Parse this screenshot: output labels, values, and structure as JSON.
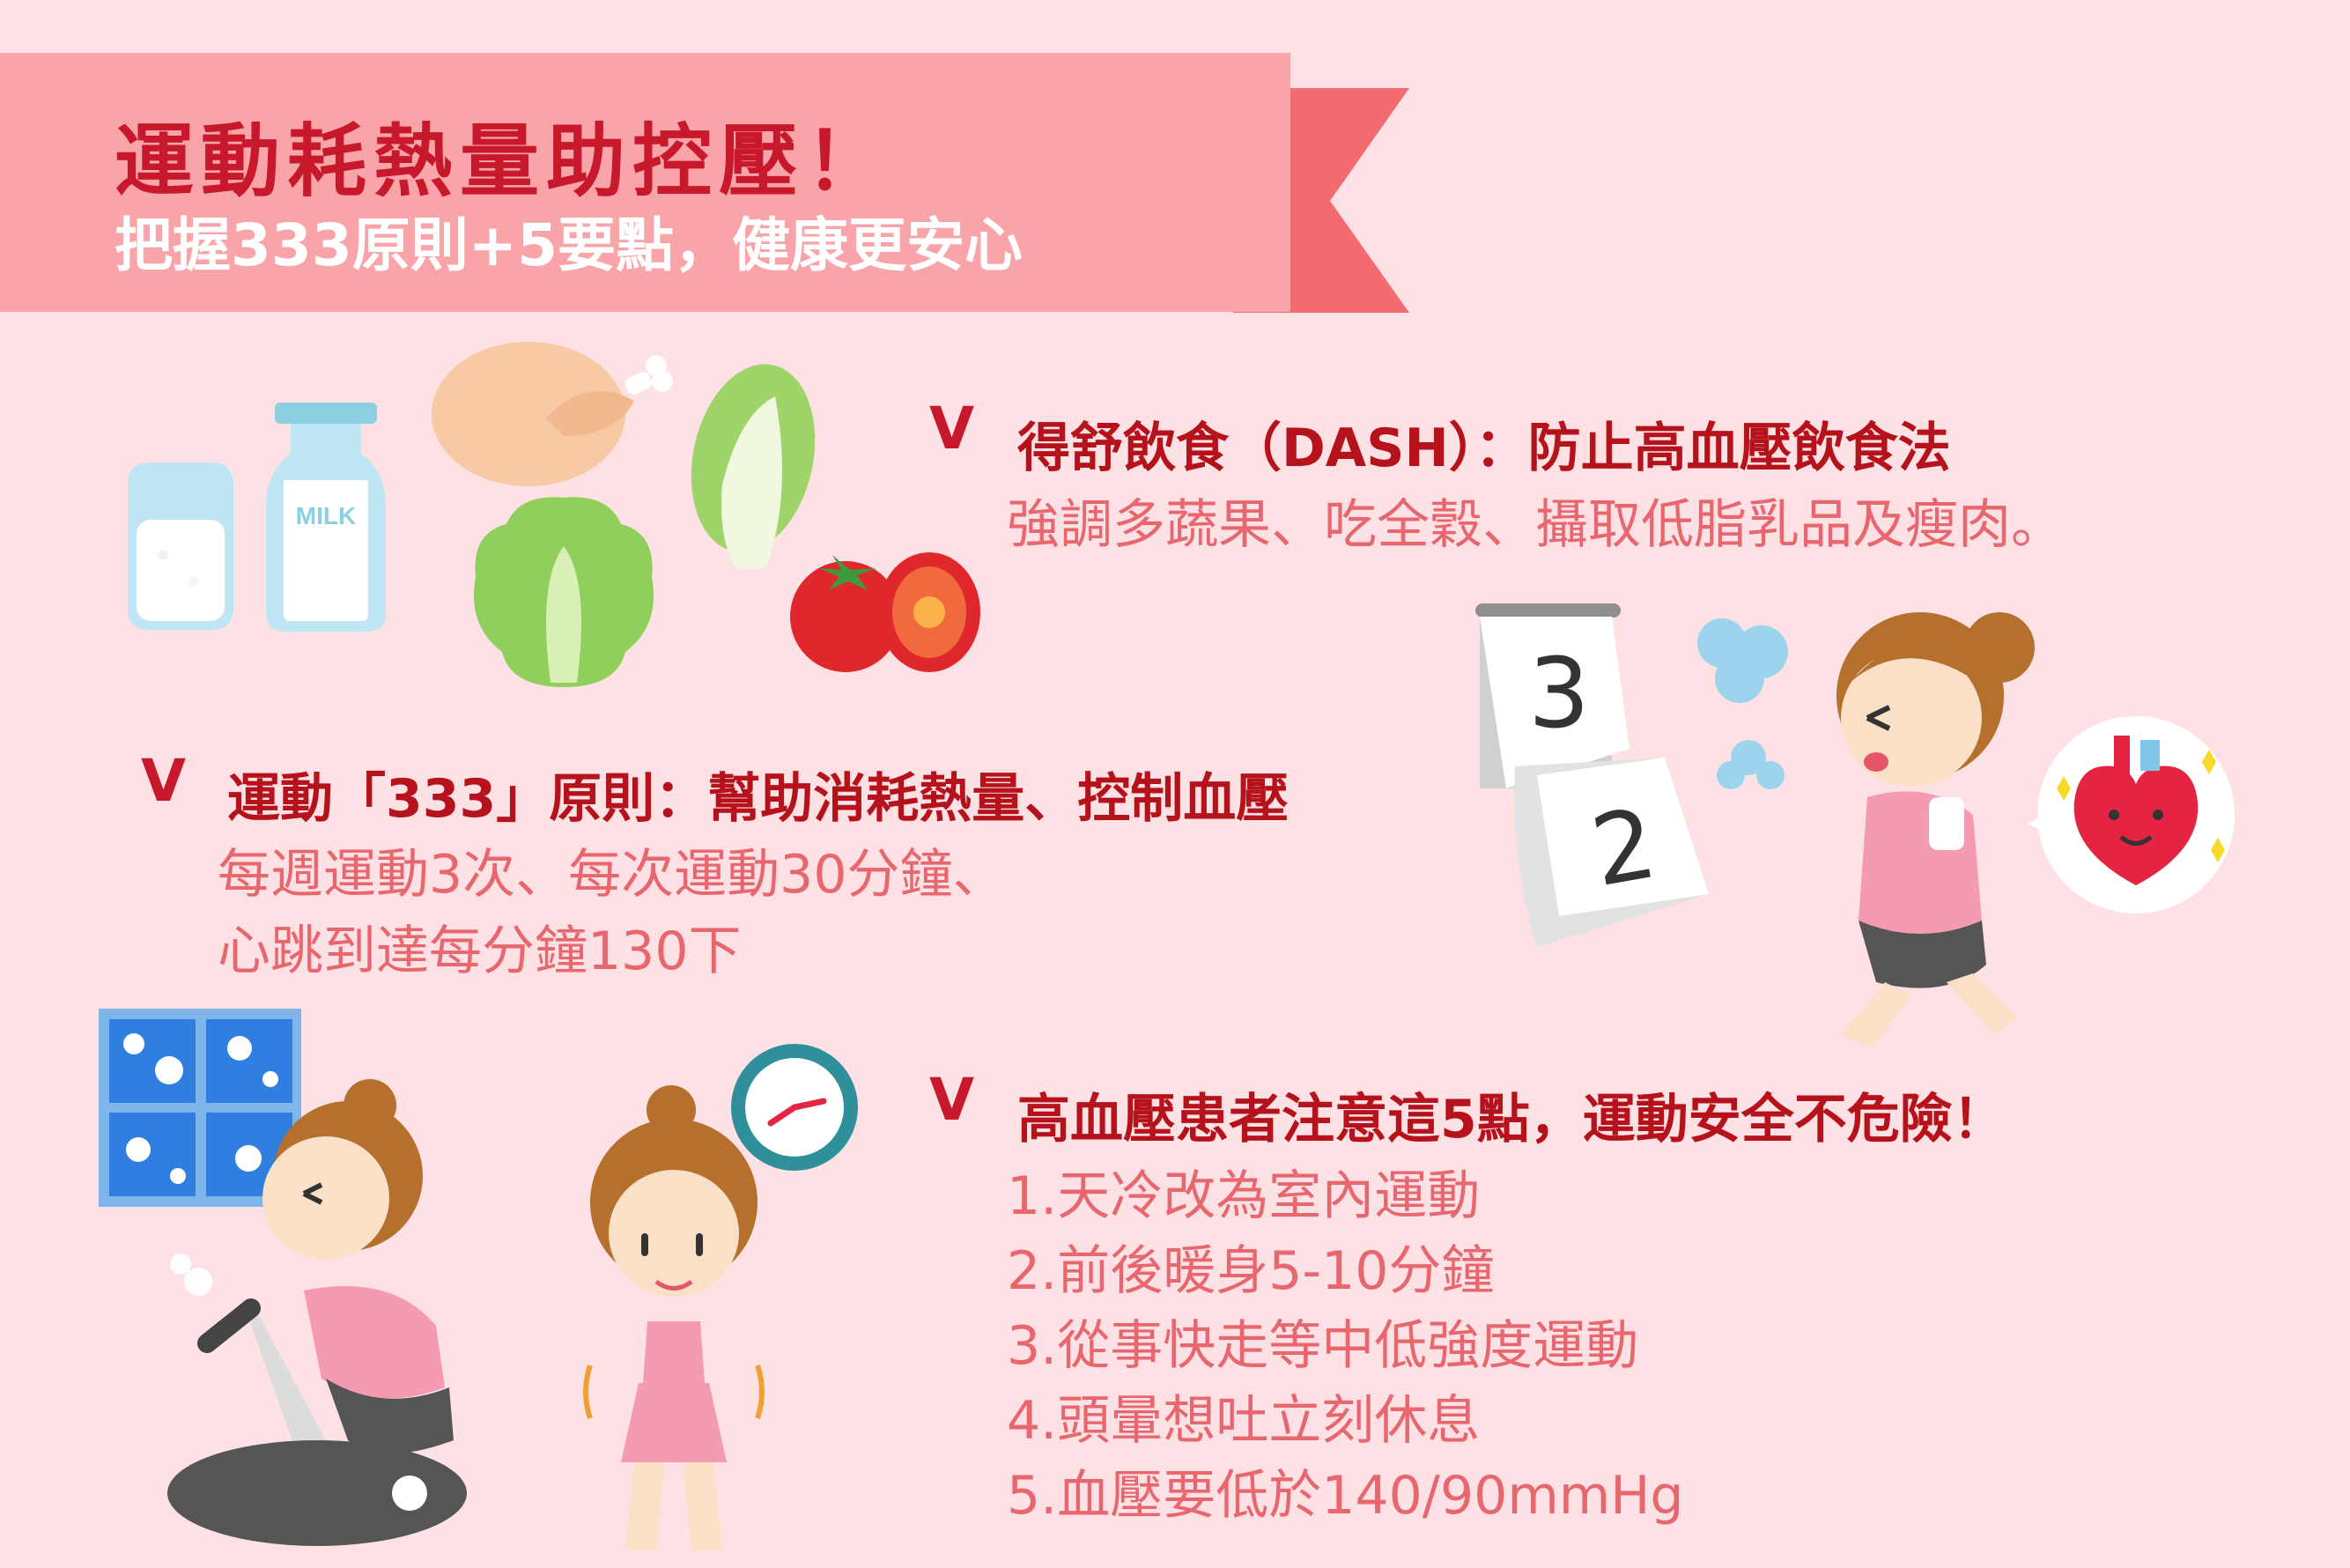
{
  "banner": {
    "title": "運動耗熱量助控壓！",
    "subtitle": "把握333原則+5要點，健康更安心"
  },
  "sections": [
    {
      "mark": "V",
      "heading": "得舒飲食（DASH）：防止高血壓飲食法",
      "lines": [
        "強調多蔬果、吃全穀、攝取低脂乳品及瘦肉。"
      ]
    },
    {
      "mark": "V",
      "heading": "運動「333」原則：幫助消耗熱量、控制血壓",
      "lines": [
        "每週運動3次、每次運動30分鐘、",
        "心跳到達每分鐘130下"
      ]
    },
    {
      "mark": "V",
      "heading": "高血壓患者注意這5點，運動安全不危險！",
      "lines": [
        "1.天冷改為室內運動",
        "2.前後暖身5-10分鐘",
        "3.從事快走等中低強度運動",
        "4.頭暈想吐立刻休息",
        "5.血壓要低於140/90mmHg"
      ]
    }
  ],
  "illustrations": {
    "milk_label": "MILK",
    "calendar_top": "3",
    "calendar_bottom": "2"
  },
  "colors": {
    "background": "#fde1e4",
    "banner": "#f9a4a8",
    "banner_tail": "#f46b6f",
    "title": "#c8182c",
    "heading": "#b5121b",
    "body": "#e8676f"
  },
  "icons": [
    "milk-glass-icon",
    "milk-bottle-icon",
    "roast-chicken-icon",
    "lettuce-icon",
    "napa-cabbage-icon",
    "tomato-icon",
    "calendar-icon",
    "jogging-woman-icon",
    "heart-icon",
    "window-icon",
    "exercise-bike-woman-icon",
    "stopwatch-icon",
    "stretching-woman-icon"
  ]
}
